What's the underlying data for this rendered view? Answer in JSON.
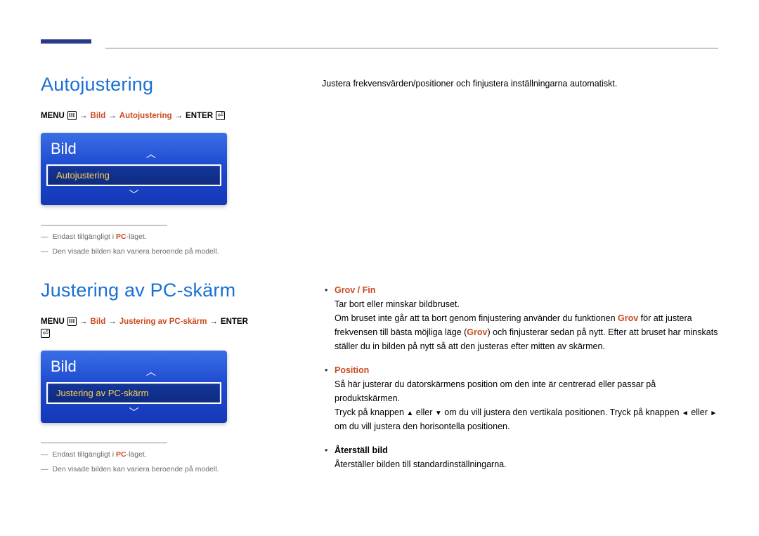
{
  "section1": {
    "title": "Autojustering",
    "breadcrumb": {
      "menu": "MENU",
      "bild": "Bild",
      "item": "Autojustering",
      "enter": "ENTER"
    },
    "osd": {
      "title": "Bild",
      "selected": "Autojustering"
    },
    "notes": {
      "line1_pre": "Endast tillgängligt i ",
      "line1_pc": "PC",
      "line1_post": "-läget.",
      "line2": "Den visade bilden kan variera beroende på modell."
    },
    "right_p1": "Justera frekvensvärden/positioner och finjustera inställningarna automatiskt."
  },
  "section2": {
    "title": "Justering av PC-skärm",
    "breadcrumb": {
      "menu": "MENU",
      "bild": "Bild",
      "item": "Justering av PC-skärm",
      "enter": "ENTER"
    },
    "osd": {
      "title": "Bild",
      "selected": "Justering av PC-skärm"
    },
    "notes": {
      "line1_pre": "Endast tillgängligt i ",
      "line1_pc": "PC",
      "line1_post": "-läget.",
      "line2": "Den visade bilden kan variera beroende på modell."
    },
    "bullets": {
      "grov_fin": {
        "title_grov": "Grov",
        "title_sep": " / ",
        "title_fin": "Fin",
        "p1": "Tar bort eller minskar bildbruset.",
        "p2_a": "Om bruset inte går att ta bort genom finjustering använder du funktionen ",
        "p2_grov1": "Grov",
        "p2_b": " för att justera frekvensen till bästa möjliga läge (",
        "p2_grov2": "Grov",
        "p2_c": ") och finjusterar sedan på nytt. Efter att bruset har minskats ställer du in bilden på nytt så att den justeras efter mitten av skärmen."
      },
      "position": {
        "title": "Position",
        "p1": "Så här justerar du datorskärmens position om den inte är centrerad eller passar på produktskärmen.",
        "p2_a": "Tryck på knappen ",
        "up": "▲",
        "p2_b": " eller ",
        "down": "▼",
        "p2_c": " om du vill justera den vertikala positionen. Tryck på knappen ",
        "left": "◄",
        "p2_d": " eller ",
        "right": "►",
        "p2_e": " om du vill justera den horisontella positionen."
      },
      "aterstall": {
        "title": "Återställ bild",
        "p1": "Återställer bilden till standardinställningarna."
      }
    }
  },
  "glyphs": {
    "arrow": "→",
    "caret_up": "︿",
    "caret_down": "﹀"
  }
}
